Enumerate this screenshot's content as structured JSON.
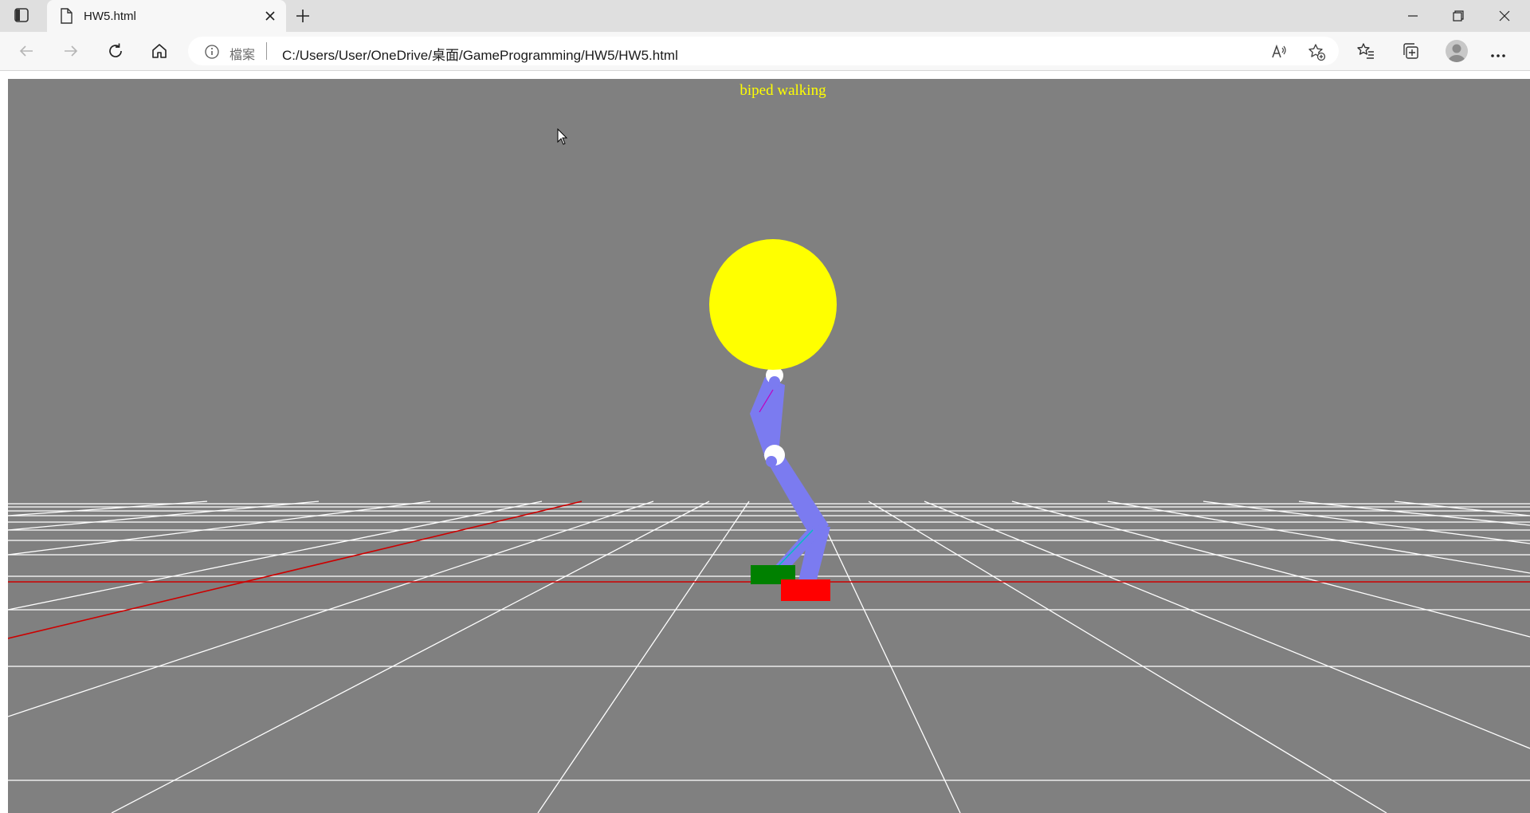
{
  "browser": {
    "tab": {
      "title": "HW5.html"
    },
    "address": {
      "scheme_label": "檔案",
      "url": "C:/Users/User/OneDrive/桌面/GameProgramming/HW5/HW5.html"
    }
  },
  "scene": {
    "title": "biped walking",
    "colors": {
      "background": "#808080",
      "grid": "#ffffff",
      "axis": "#cc0000",
      "head": "#ffff00",
      "limbs": "#7b7bf0",
      "joints": "#ffffff",
      "left_foot": "#008000",
      "right_foot": "#ff0000",
      "bone_line": "#00c0c0"
    }
  }
}
